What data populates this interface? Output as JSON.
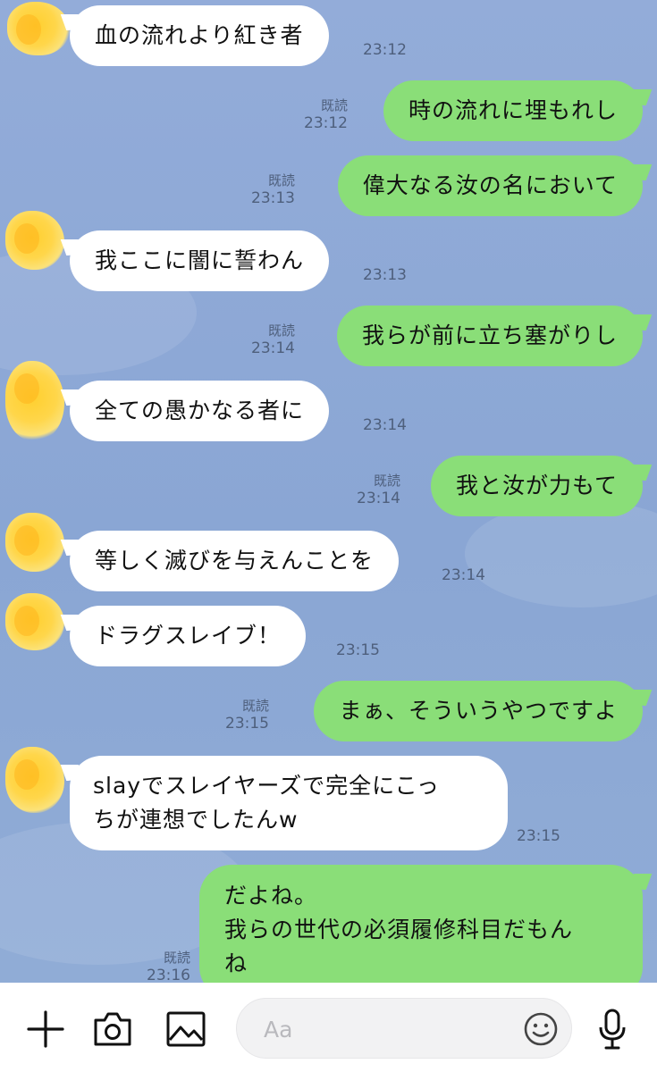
{
  "messages": [
    {
      "side": "in",
      "text": "血の流れより紅き者",
      "time": "23:12",
      "read": ""
    },
    {
      "side": "out",
      "text": "時の流れに埋もれし",
      "time": "23:12",
      "read": "既読"
    },
    {
      "side": "out",
      "text": "偉大なる汝の名において",
      "time": "23:13",
      "read": "既読"
    },
    {
      "side": "in",
      "text": "我ここに闇に誓わん",
      "time": "23:13",
      "read": ""
    },
    {
      "side": "out",
      "text": "我らが前に立ち塞がりし",
      "time": "23:14",
      "read": "既読"
    },
    {
      "side": "in",
      "text": "全ての愚かなる者に",
      "time": "23:14",
      "read": ""
    },
    {
      "side": "out",
      "text": "我と汝が力もて",
      "time": "23:14",
      "read": "既読"
    },
    {
      "side": "in",
      "text": "等しく滅びを与えんことを",
      "time": "23:14",
      "read": ""
    },
    {
      "side": "in",
      "text": "ドラグスレイブ！",
      "time": "23:15",
      "read": ""
    },
    {
      "side": "out",
      "text": "まぁ、そういうやつですよ",
      "time": "23:15",
      "read": "既読"
    },
    {
      "side": "in",
      "text": "slayでスレイヤーズで完全にこっ\nちが連想でしたんw",
      "time": "23:15",
      "read": ""
    },
    {
      "side": "out",
      "text": "だよね。\n我らの世代の必須履修科目だもん\nね",
      "time": "23:16",
      "read": "既読"
    }
  ],
  "input_bar": {
    "placeholder": "Aa",
    "icons": [
      "plus-icon",
      "camera-icon",
      "image-icon",
      "emoji-icon",
      "microphone-icon"
    ]
  },
  "colors": {
    "background": "#8eaad6",
    "incoming_bubble": "#ffffff",
    "outgoing_bubble": "#8ade78",
    "meta_text": "#4e5f7c"
  }
}
